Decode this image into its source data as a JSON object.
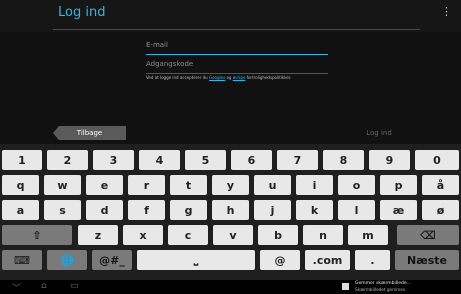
{
  "app": {
    "title": "Log ind",
    "menu_icon": "overflow-menu-icon"
  },
  "form": {
    "email_placeholder": "E-mail",
    "password_placeholder": "Adgangskode",
    "terms_prefix": "Ved at logge ind accepterer du ",
    "terms_link1": "Googles",
    "terms_mid": " og ",
    "terms_link2": "øvrige",
    "terms_suffix": " fortrolighedspolitikker."
  },
  "actions": {
    "back": "Tilbage",
    "login": "Log ind"
  },
  "keyboard": {
    "row1": [
      "1",
      "2",
      "3",
      "4",
      "5",
      "6",
      "7",
      "8",
      "9",
      "0"
    ],
    "row2": [
      "q",
      "w",
      "e",
      "r",
      "t",
      "y",
      "u",
      "i",
      "o",
      "p",
      "å"
    ],
    "row3": [
      "a",
      "s",
      "d",
      "f",
      "g",
      "h",
      "j",
      "k",
      "l",
      "æ",
      "ø"
    ],
    "row4": [
      "z",
      "x",
      "c",
      "v",
      "b",
      "n",
      "m"
    ],
    "shift_glyph": "⇧",
    "backspace_glyph": "⌫",
    "keyboard_glyph": "⌨",
    "globe_glyph": "🌐",
    "symbols": "@#_",
    "space_glyph": "⎵",
    "at": "@",
    "dotcom": ".com",
    "period": ".",
    "next": "Næste"
  },
  "statusbar": {
    "notification_title": "Gemmer skærmbillede...",
    "notification_sub": "Skærmbilledet gemmes."
  },
  "colors": {
    "accent": "#33b5e5"
  }
}
